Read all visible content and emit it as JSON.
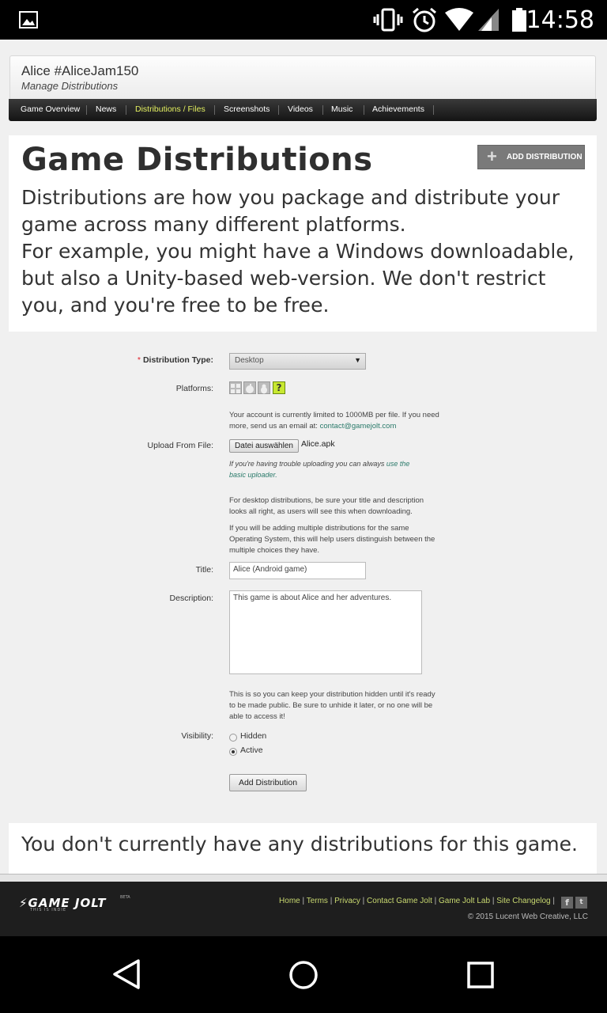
{
  "statusbar": {
    "time": "14:58"
  },
  "game": {
    "title": "Alice #AliceJam150",
    "subtitle": "Manage Distributions"
  },
  "nav": {
    "items": [
      "Game Overview",
      "News",
      "Distributions / Files",
      "Screenshots",
      "Videos",
      "Music",
      "Achievements"
    ],
    "active_index": 2,
    "active_color": "#e4f060"
  },
  "intro": {
    "heading": "Game Distributions",
    "add_button": "ADD DISTRIBUTION",
    "line1": "Distributions are how you package and distribute your game across many different platforms.",
    "line2": "For example, you might have a Windows downloadable, but also a Unity-based web-version. We don't restrict you, and you're free to be free."
  },
  "form": {
    "required_mark": "*",
    "dist_type_label": "Distribution Type:",
    "dist_type_value": "Desktop",
    "platforms_label": "Platforms:",
    "platform_icons": [
      "windows-icon",
      "apple-icon",
      "linux-icon",
      "other-icon"
    ],
    "limit_note": "Your account is currently limited to 1000MB per file. If you need more, send us an email at:",
    "contact_email": "contact@gamejolt.com",
    "upload_label": "Upload From File:",
    "file_button": "Datei auswählen",
    "file_name": "Alice.apk",
    "trouble_note": "If you're having trouble uploading you can always",
    "basic_uploader": "use the basic uploader.",
    "desktop_note": "For desktop distributions, be sure your title and description looks all right, as users will see this when downloading.",
    "multiple_note": "If you will be adding multiple distributions for the same Operating System, this will help users distinguish between the multiple choices they have.",
    "title_label": "Title:",
    "title_value": "Alice (Android game)",
    "description_label": "Description:",
    "description_value": "This game is about Alice and her adventures.",
    "hidden_note": "This is so you can keep your distribution hidden until it's ready to be made public. Be sure to unhide it later, or no one will be able to access it!",
    "visibility_label": "Visibility:",
    "visibility_options": [
      "Hidden",
      "Active"
    ],
    "visibility_selected": "Active",
    "submit_label": "Add Distribution"
  },
  "empty_message": "You don't currently have any distributions for this game.",
  "footer": {
    "logo": "GAME JOLT",
    "tagline": "THIS IS INDIE",
    "beta": "BETA",
    "links": [
      "Home",
      "Terms",
      "Privacy",
      "Contact Game Jolt",
      "Game Jolt Lab",
      "Site Changelog"
    ],
    "copyright": "© 2015 Lucent Web Creative, LLC"
  }
}
